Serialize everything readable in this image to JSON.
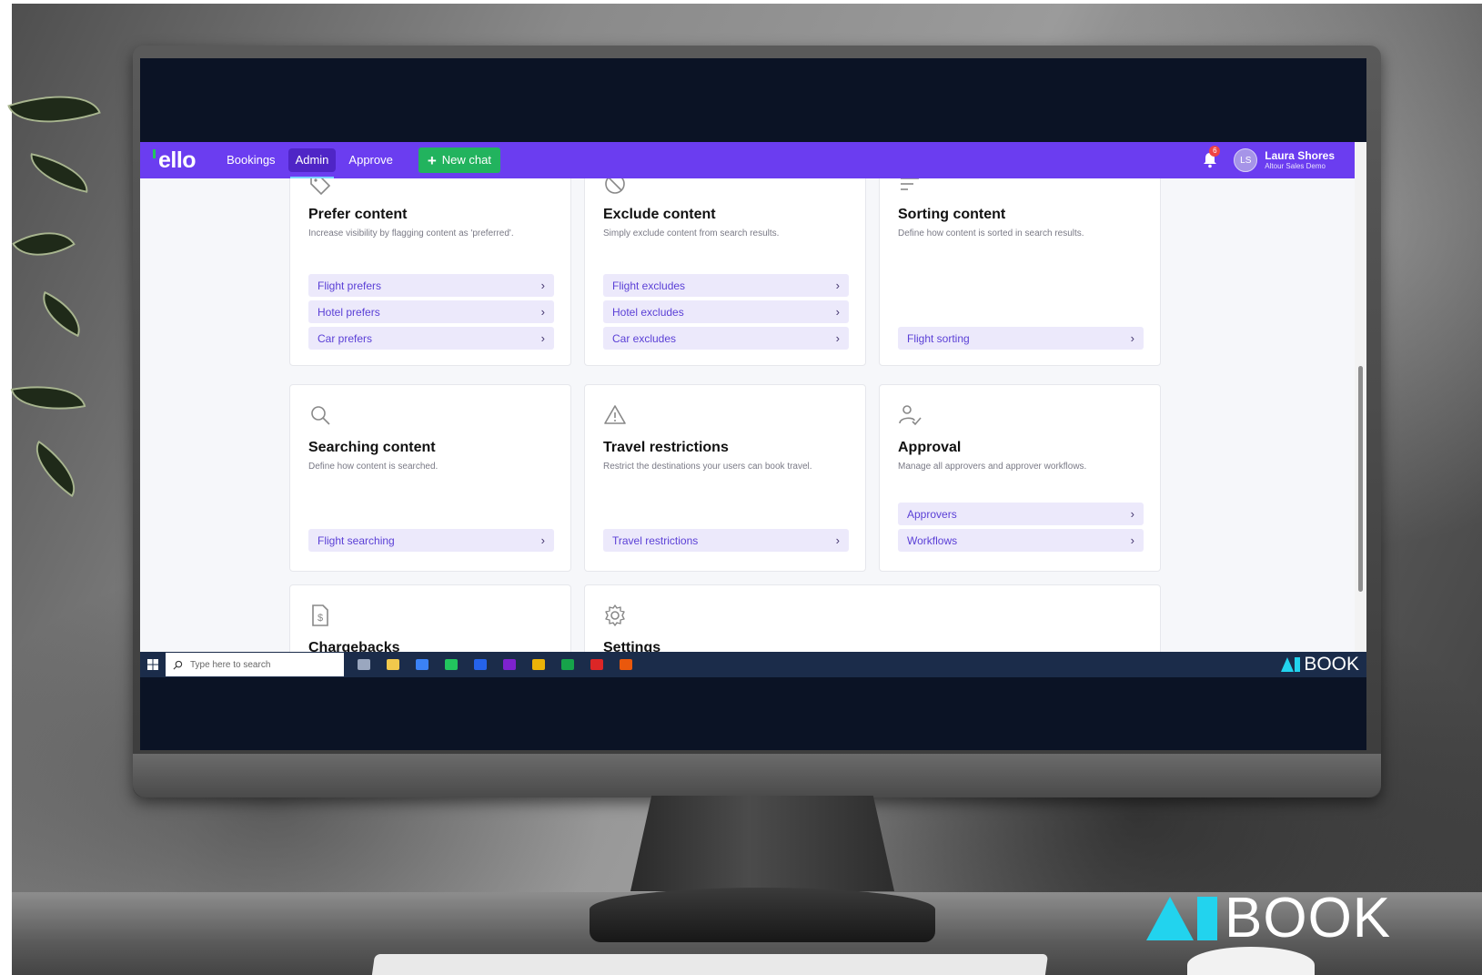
{
  "app": {
    "logo": "ello",
    "nav": [
      {
        "label": "Bookings",
        "active": false
      },
      {
        "label": "Admin",
        "active": true
      },
      {
        "label": "Approve",
        "active": false
      }
    ],
    "new_chat_label": "New chat",
    "notifications_count": "6",
    "user": {
      "initials": "LS",
      "name": "Laura Shores",
      "org": "Altour Sales Demo"
    }
  },
  "cards": [
    {
      "icon": "tag-icon",
      "title": "Prefer content",
      "description": "Increase visibility by flagging content as 'preferred'.",
      "links": [
        "Flight prefers",
        "Hotel prefers",
        "Car prefers"
      ]
    },
    {
      "icon": "block-icon",
      "title": "Exclude content",
      "description": "Simply exclude content from search results.",
      "links": [
        "Flight excludes",
        "Hotel excludes",
        "Car excludes"
      ]
    },
    {
      "icon": "sort-icon",
      "title": "Sorting content",
      "description": "Define how content is sorted in search results.",
      "links": [
        "Flight sorting"
      ]
    },
    {
      "icon": "search-icon",
      "title": "Searching content",
      "description": "Define how content is searched.",
      "links": [
        "Flight searching"
      ]
    },
    {
      "icon": "warning-icon",
      "title": "Travel restrictions",
      "description": "Restrict the destinations your users can book travel.",
      "links": [
        "Travel restrictions"
      ]
    },
    {
      "icon": "user-check-icon",
      "title": "Approval",
      "description": "Manage all approvers and approver workflows.",
      "links": [
        "Approvers",
        "Workflows"
      ]
    },
    {
      "icon": "document-dollar-icon",
      "title": "Chargebacks",
      "description": "",
      "links": []
    },
    {
      "icon": "gear-icon",
      "title": "Settings",
      "description": "",
      "links": []
    }
  ],
  "taskbar": {
    "search_placeholder": "Type here to search",
    "apps": [
      {
        "icon": "task-view-icon",
        "color": "#9aa7bf"
      },
      {
        "icon": "file-explorer-icon",
        "color": "#f2c94c"
      },
      {
        "icon": "calendar-app-icon",
        "color": "#3b82f6"
      },
      {
        "icon": "edge-icon",
        "color": "#22c55e"
      },
      {
        "icon": "outlook-icon",
        "color": "#2563eb"
      },
      {
        "icon": "onenote-icon",
        "color": "#7e22ce"
      },
      {
        "icon": "chrome-icon",
        "color": "#eab308"
      },
      {
        "icon": "excel-icon",
        "color": "#16a34a"
      },
      {
        "icon": "red-app-icon",
        "color": "#dc2626"
      },
      {
        "icon": "teams-icon",
        "color": "#ea580c"
      }
    ],
    "brand": "BOOK"
  },
  "watermark": {
    "text": "BOOK",
    "accent": "#22d3ee"
  },
  "colors": {
    "navbar": "#6b3df0",
    "new_chat": "#22b35e",
    "link_bg": "#ece9fb",
    "link_text": "#5a3fd6"
  }
}
